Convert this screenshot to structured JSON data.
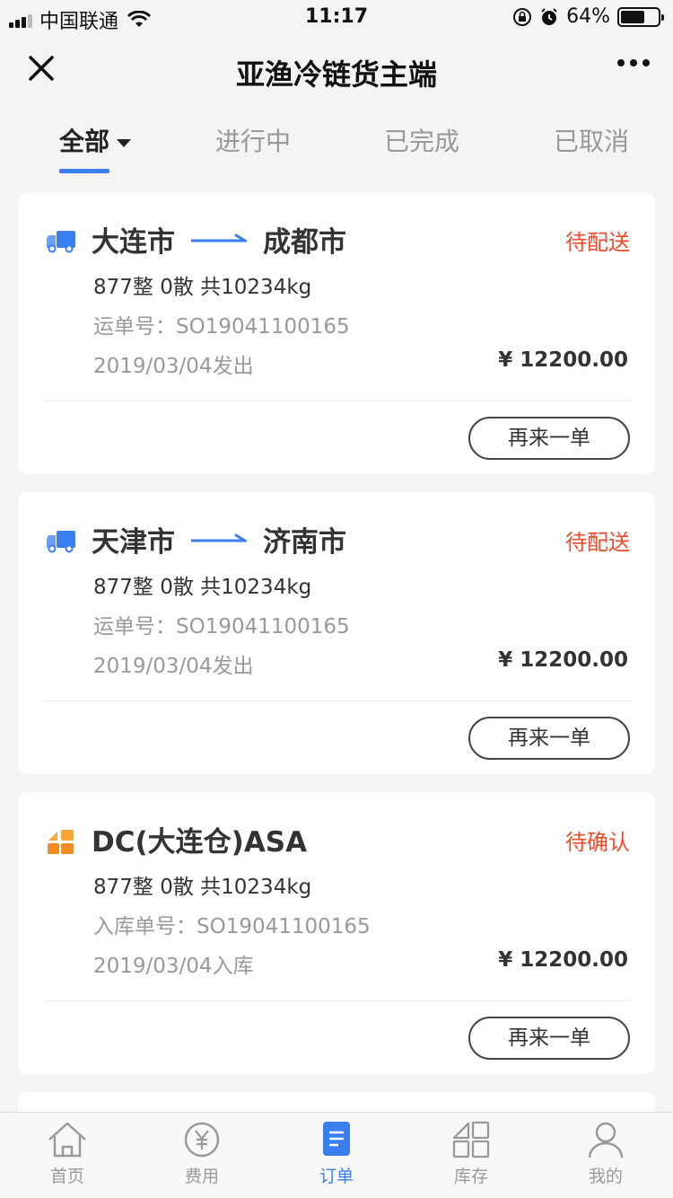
{
  "status_bar": {
    "carrier": "中国联通",
    "time": "11:17",
    "battery": "64%"
  },
  "header": {
    "title": "亚渔冷链货主端"
  },
  "tabs": [
    {
      "label": "全部",
      "active": true
    },
    {
      "label": "进行中",
      "active": false
    },
    {
      "label": "已完成",
      "active": false
    },
    {
      "label": "已取消",
      "active": false
    }
  ],
  "orders": [
    {
      "type": "transport",
      "from": "大连市",
      "to": "成都市",
      "status": "待配送",
      "quantity": "877整  0散  共10234kg",
      "waybill": "运单号：SO19041100165",
      "date": "2019/03/04发出",
      "price": "¥ 12200.00",
      "action": "再来一单"
    },
    {
      "type": "transport",
      "from": "天津市",
      "to": "济南市",
      "status": "待配送",
      "quantity": "877整  0散  共10234kg",
      "waybill": "运单号：SO19041100165",
      "date": "2019/03/04发出",
      "price": "¥ 12200.00",
      "action": "再来一单"
    },
    {
      "type": "warehouse",
      "title": "DC(大连仓)ASA",
      "status": "待确认",
      "quantity": "877整  0散  共10234kg",
      "waybill": "入库单号：SO19041100165",
      "date": "2019/03/04入库",
      "price": "¥ 12200.00",
      "action": "再来一单"
    }
  ],
  "tabbar": [
    {
      "label": "首页",
      "icon": "home-icon"
    },
    {
      "label": "费用",
      "icon": "yuan-icon"
    },
    {
      "label": "订单",
      "icon": "order-icon",
      "active": true
    },
    {
      "label": "库存",
      "icon": "inventory-icon"
    },
    {
      "label": "我的",
      "icon": "profile-icon"
    }
  ],
  "colors": {
    "accent": "#3a7ef0",
    "status": "#ee4b2b"
  }
}
